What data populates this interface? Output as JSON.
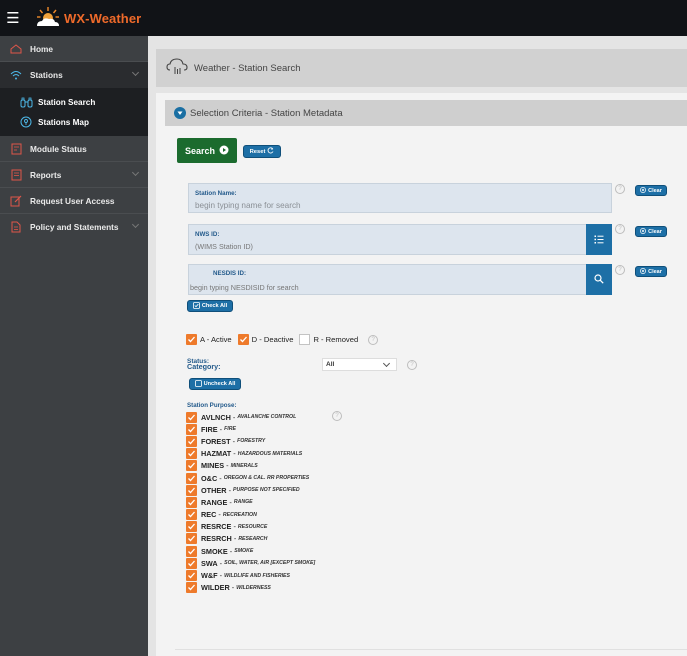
{
  "app": {
    "brand": "WX-Weather"
  },
  "sidebar": {
    "items": [
      {
        "label": "Home",
        "icon": "home-icon"
      },
      {
        "label": "Stations",
        "icon": "wifi-icon"
      },
      {
        "label": "Module Status",
        "icon": "module-icon"
      },
      {
        "label": "Reports",
        "icon": "report-icon"
      },
      {
        "label": "Request User Access",
        "icon": "edit-icon"
      },
      {
        "label": "Policy and Statements",
        "icon": "document-icon"
      }
    ],
    "sub_items": [
      {
        "label": "Station Search",
        "icon": "binoculars-icon"
      },
      {
        "label": "Stations Map",
        "icon": "map-pin-icon"
      }
    ]
  },
  "page": {
    "title": "Weather - Station Search"
  },
  "section": {
    "title": "Selection Criteria - Station Metadata"
  },
  "buttons": {
    "search": "Search",
    "reset": "Reset",
    "clear": "Clear",
    "check_all": "Check All",
    "uncheck_all": "Uncheck All"
  },
  "fields": {
    "station_name": {
      "label": "Station Name:",
      "placeholder": "begin typing name for search"
    },
    "nws_id": {
      "label": "NWS ID:",
      "placeholder": "(WIMS Station ID)"
    },
    "nesdis_id": {
      "label": "NESDIS ID:",
      "placeholder": "begin typing NESDISID for search"
    }
  },
  "status": {
    "label": "Status:",
    "options": [
      {
        "label": "A - Active",
        "checked": true
      },
      {
        "label": "D - Deactive",
        "checked": true
      },
      {
        "label": "R - Removed",
        "checked": false
      }
    ]
  },
  "category": {
    "label": "Category:",
    "selected": "All"
  },
  "purpose": {
    "label": "Station Purpose:",
    "items": [
      {
        "code": "AVLNCH",
        "desc": "AVALANCHE CONTROL",
        "checked": true
      },
      {
        "code": "FIRE",
        "desc": "FIRE",
        "checked": true
      },
      {
        "code": "FOREST",
        "desc": "FORESTRY",
        "checked": true
      },
      {
        "code": "HAZMAT",
        "desc": "HAZARDOUS MATERIALS",
        "checked": true
      },
      {
        "code": "MINES",
        "desc": "MINERALS",
        "checked": true
      },
      {
        "code": "O&C",
        "desc": "OREGON & CAL. RR PROPERTIES",
        "checked": true
      },
      {
        "code": "OTHER",
        "desc": "PURPOSE NOT SPECIFIED",
        "checked": true
      },
      {
        "code": "RANGE",
        "desc": "RANGE",
        "checked": true
      },
      {
        "code": "REC",
        "desc": "RECREATION",
        "checked": true
      },
      {
        "code": "RESRCE",
        "desc": "RESOURCE",
        "checked": true
      },
      {
        "code": "RESRCH",
        "desc": "RESEARCH",
        "checked": true
      },
      {
        "code": "SMOKE",
        "desc": "SMOKE",
        "checked": true
      },
      {
        "code": "SWA",
        "desc": "SOIL, WATER, AIR [Except SMOKE]",
        "checked": true
      },
      {
        "code": "W&F",
        "desc": "WILDLIFE AND FISHERIES",
        "checked": true
      },
      {
        "code": "WILDER",
        "desc": "WILDERNESS",
        "checked": true
      }
    ]
  },
  "colors": {
    "accent_blue": "#1d6fa6",
    "search_green": "#1b6b2e",
    "checkbox_orange": "#ee7a2b",
    "brand_orange": "#ef6a2a",
    "sidebar_bg": "#3d4043",
    "topbar_bg": "#111317"
  }
}
